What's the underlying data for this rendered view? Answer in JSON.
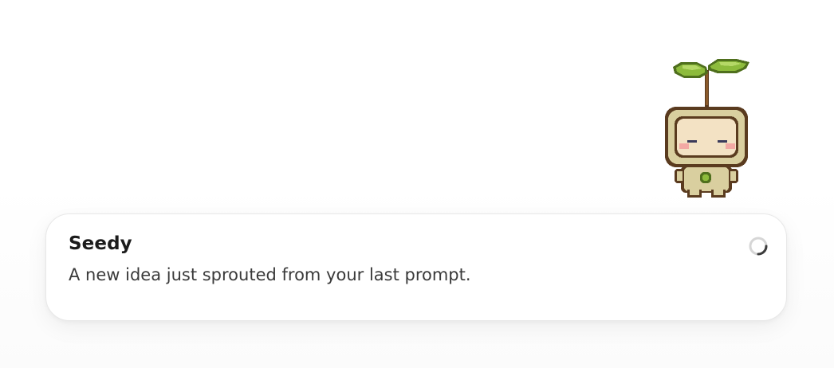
{
  "notification": {
    "title": "Seedy",
    "message": "A new idea just sprouted from your last prompt."
  },
  "mascot": {
    "icon": "seedling-sprite-icon"
  },
  "status": {
    "icon": "loading-spinner-icon"
  },
  "colors": {
    "card_background": "#ffffff",
    "card_border": "#e8e8e8",
    "title_text": "#1c1c1c",
    "message_text": "#3a3a3a",
    "leaf_green": "#8dbb3c",
    "sprite_outline": "#5a3b1f"
  }
}
